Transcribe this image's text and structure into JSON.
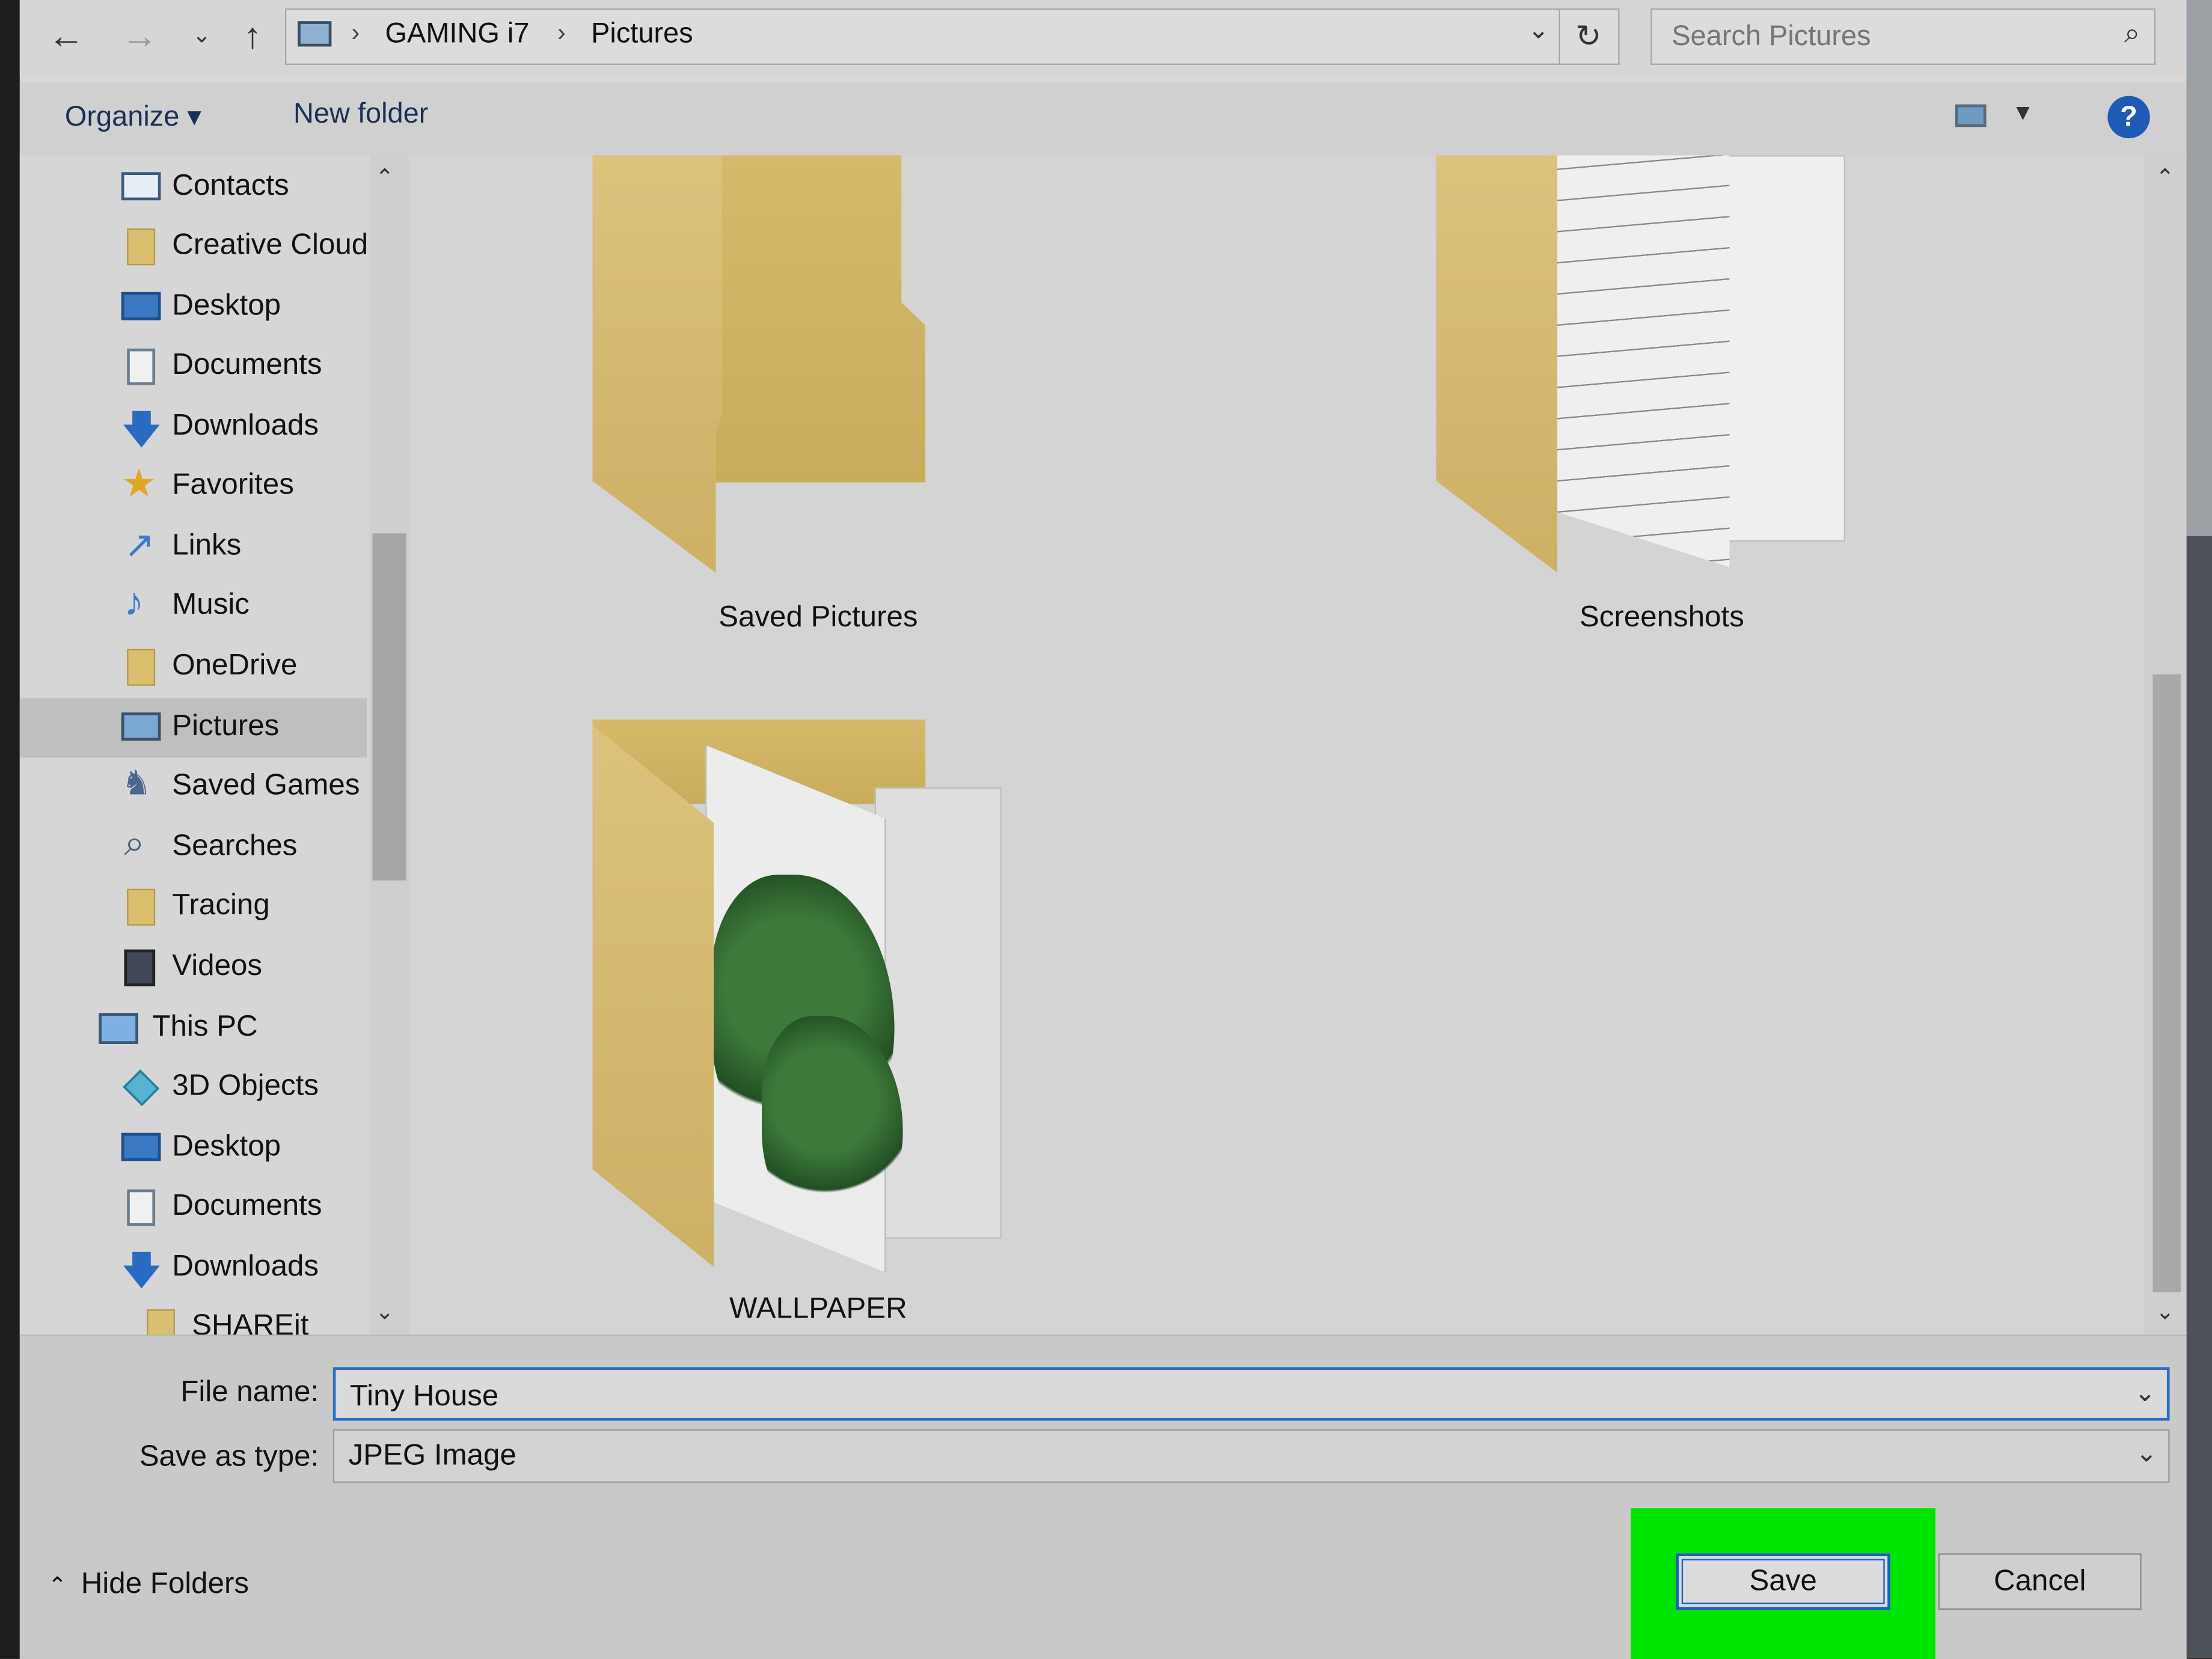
{
  "address_bar": {
    "crumbs": [
      "GAMING i7",
      "Pictures"
    ],
    "search_placeholder": "Search Pictures"
  },
  "toolbar": {
    "organize_label": "Organize ▾",
    "new_folder_label": "New folder",
    "help_label": "?"
  },
  "nav_items": [
    {
      "label": "Contacts",
      "icon": "contacts-icon"
    },
    {
      "label": "Creative Cloud",
      "icon": "folder-icon"
    },
    {
      "label": "Desktop",
      "icon": "desktop-icon"
    },
    {
      "label": "Documents",
      "icon": "documents-icon"
    },
    {
      "label": "Downloads",
      "icon": "download-arrow-icon"
    },
    {
      "label": "Favorites",
      "icon": "star-icon"
    },
    {
      "label": "Links",
      "icon": "link-arrow-icon"
    },
    {
      "label": "Music",
      "icon": "music-note-icon"
    },
    {
      "label": "OneDrive",
      "icon": "folder-icon"
    },
    {
      "label": "Pictures",
      "icon": "pictures-icon",
      "selected": true
    },
    {
      "label": "Saved Games",
      "icon": "saved-games-icon"
    },
    {
      "label": "Searches",
      "icon": "search-icon"
    },
    {
      "label": "Tracing",
      "icon": "folder-icon"
    },
    {
      "label": "Videos",
      "icon": "film-icon"
    },
    {
      "label": "This PC",
      "icon": "computer-icon"
    },
    {
      "label": "3D Objects",
      "icon": "cube-icon"
    },
    {
      "label": "Desktop",
      "icon": "desktop-icon"
    },
    {
      "label": "Documents",
      "icon": "documents-icon"
    },
    {
      "label": "Downloads",
      "icon": "download-arrow-icon"
    },
    {
      "label": "SHAREit",
      "icon": "folder-icon"
    }
  ],
  "folders": [
    {
      "name": "Saved Pictures"
    },
    {
      "name": "Screenshots"
    },
    {
      "name": "WALLPAPER"
    }
  ],
  "file_name": {
    "label": "File name:",
    "value": "Tiny House"
  },
  "save_as_type": {
    "label": "Save as type:",
    "value": "JPEG Image"
  },
  "hide_folders_label": "Hide Folders",
  "save_label": "Save",
  "cancel_label": "Cancel",
  "colors": {
    "highlight": "#00e500",
    "accent": "#1a5fc0"
  }
}
